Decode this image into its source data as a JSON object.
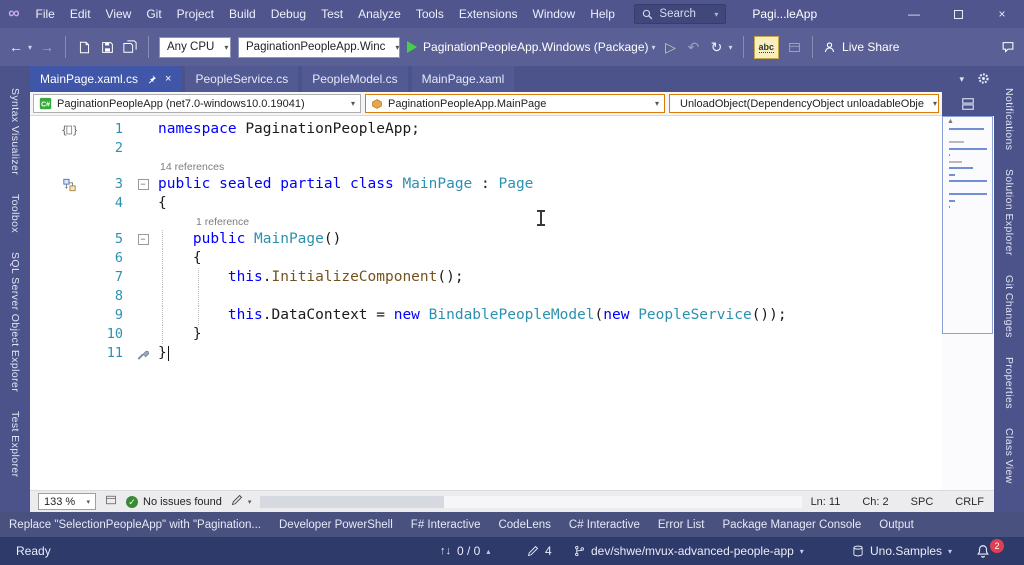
{
  "colors": {
    "frame": "#4c538a",
    "titlebar": "#50568d",
    "toolbar": "#5a6095",
    "tab_active": "#4056a8",
    "tab_inactive": "#525a94",
    "statusbar": "#2e3a6a",
    "panel_tabs": "#49527f",
    "accent_orange": "#d97c0a",
    "keyword": "#0000ff",
    "type": "#2b91af",
    "method": "#74531f",
    "plain": "#1b1b1b",
    "line_number": "#2b91af",
    "codelens": "#7d7d7d",
    "check_green": "#388a34",
    "run_green": "#43d14c",
    "badge_red": "#e03e52"
  },
  "icons": {
    "caret_down": "▾",
    "caret_up": "▴",
    "close": "×",
    "minimize": "—",
    "back": "←",
    "forward": "→",
    "undo": "↶",
    "refresh": "↻",
    "play_outline": "▷",
    "check": "✓",
    "fold": "−",
    "sync": "↑↓",
    "scroll_up": "▲"
  },
  "titlebar": {
    "menus": [
      "File",
      "Edit",
      "View",
      "Git",
      "Project",
      "Build",
      "Debug",
      "Test",
      "Analyze",
      "Tools",
      "Extensions",
      "Window",
      "Help"
    ],
    "search_label": "Search",
    "window_title": "Pagi...leApp"
  },
  "toolbar": {
    "platform": "Any CPU",
    "startup_project": "PaginationPeopleApp.Winc",
    "run_target": "PaginationPeopleApp.Windows (Package)",
    "spellcheck_label": "abc",
    "live_share_label": "Live Share"
  },
  "tabs": [
    {
      "label": "MainPage.xaml.cs",
      "active": true
    },
    {
      "label": "PeopleService.cs",
      "active": false
    },
    {
      "label": "PeopleModel.cs",
      "active": false
    },
    {
      "label": "MainPage.xaml",
      "active": false
    }
  ],
  "navbar": {
    "project": "PaginationPeopleApp (net7.0-windows10.0.19041)",
    "type": "PaginationPeopleApp.MainPage",
    "member": "UnloadObject(DependencyObject unloadableObje"
  },
  "left_rail": [
    "Syntax Visualizer",
    "Toolbox",
    "SQL Server Object Explorer",
    "Test Explorer"
  ],
  "right_rail": [
    "Notifications",
    "Solution Explorer",
    "Git Changes",
    "Properties",
    "Class View"
  ],
  "editor": {
    "rows": [
      {
        "n": "1",
        "icon": "ns",
        "tokens": [
          [
            "k",
            "namespace "
          ],
          [
            "p",
            "PaginationPeopleApp;"
          ]
        ]
      },
      {
        "n": "2",
        "tokens": []
      },
      {
        "lens": "14 references",
        "lensIndent": 0
      },
      {
        "n": "3",
        "icon": "inherit",
        "fold": true,
        "tokens": [
          [
            "k",
            "public sealed partial class "
          ],
          [
            "t",
            "MainPage"
          ],
          [
            "p",
            " : "
          ],
          [
            "t",
            "Page"
          ]
        ]
      },
      {
        "n": "4",
        "tokens": [
          [
            "p",
            "{"
          ]
        ]
      },
      {
        "lens": "1 reference",
        "lensIndent": 1
      },
      {
        "n": "5",
        "fold": true,
        "guides": [
          0
        ],
        "tokens": [
          [
            "p",
            "    "
          ],
          [
            "k",
            "public "
          ],
          [
            "t",
            "MainPage"
          ],
          [
            "p",
            "()"
          ]
        ]
      },
      {
        "n": "6",
        "guides": [
          0
        ],
        "tokens": [
          [
            "p",
            "    {"
          ]
        ]
      },
      {
        "n": "7",
        "guides": [
          0,
          1
        ],
        "tokens": [
          [
            "p",
            "        "
          ],
          [
            "k",
            "this"
          ],
          [
            "p",
            "."
          ],
          [
            "m",
            "InitializeComponent"
          ],
          [
            "p",
            "();"
          ]
        ]
      },
      {
        "n": "8",
        "guides": [
          0,
          1
        ],
        "tokens": []
      },
      {
        "n": "9",
        "guides": [
          0,
          1
        ],
        "tokens": [
          [
            "p",
            "        "
          ],
          [
            "k",
            "this"
          ],
          [
            "p",
            ".DataContext = "
          ],
          [
            "k",
            "new"
          ],
          [
            "p",
            " "
          ],
          [
            "t",
            "BindablePeopleModel"
          ],
          [
            "p",
            "("
          ],
          [
            "k",
            "new"
          ],
          [
            "p",
            " "
          ],
          [
            "t",
            "PeopleService"
          ],
          [
            "p",
            "());"
          ]
        ]
      },
      {
        "n": "10",
        "guides": [
          0
        ],
        "tokens": [
          [
            "p",
            "    }"
          ]
        ]
      },
      {
        "n": "11",
        "icon": "wrench",
        "caret": true,
        "tokens": [
          [
            "p",
            "}"
          ]
        ]
      }
    ]
  },
  "editor_status": {
    "zoom": "133 %",
    "health": "No issues found",
    "line": "Ln: 11",
    "column": "Ch: 2",
    "spaces": "SPC",
    "line_ending": "CRLF"
  },
  "panel_tabs": [
    "Replace \"SelectionPeopleApp\" with \"Pagination...",
    "Developer PowerShell",
    "F# Interactive",
    "CodeLens",
    "C# Interactive",
    "Error List",
    "Package Manager Console",
    "Output"
  ],
  "statusbar": {
    "ready": "Ready",
    "sync_count": "0 / 0",
    "pending_edits": "4",
    "branch": "dev/shwe/mvux-advanced-people-app",
    "repo": "Uno.Samples",
    "notification_count": "2"
  }
}
